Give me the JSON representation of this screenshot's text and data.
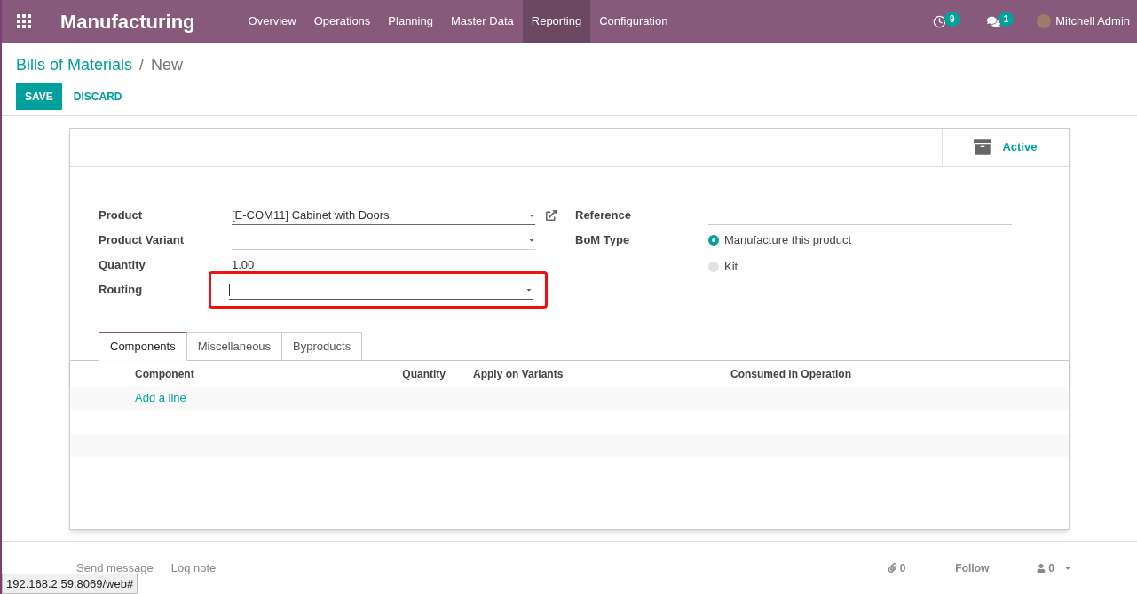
{
  "navbar": {
    "app_title": "Manufacturing",
    "menu": [
      {
        "label": "Overview",
        "selected": false
      },
      {
        "label": "Operations",
        "selected": false
      },
      {
        "label": "Planning",
        "selected": false
      },
      {
        "label": "Master Data",
        "selected": false
      },
      {
        "label": "Reporting",
        "selected": true
      },
      {
        "label": "Configuration",
        "selected": false
      }
    ],
    "activity_count": "9",
    "message_count": "1",
    "user": "Mitchell Admin"
  },
  "breadcrumb": {
    "parent": "Bills of Materials",
    "separator": "/",
    "current": "New"
  },
  "buttons": {
    "save": "SAVE",
    "discard": "DISCARD"
  },
  "status_button": {
    "label": "Active"
  },
  "left_fields": [
    {
      "label": "Product",
      "kind": "select",
      "value": "[E-COM11] Cabinet with Doors",
      "highlighted": false,
      "focused": false,
      "external_link": true
    },
    {
      "label": "Product Variant",
      "kind": "select",
      "highlighted": false,
      "focused": false,
      "external_link": false
    },
    {
      "label": "Quantity",
      "kind": "text",
      "value": "1.00",
      "highlighted": false,
      "focused": false,
      "external_link": false
    },
    {
      "label": "Routing",
      "kind": "select",
      "highlighted": true,
      "focused": true,
      "external_link": false
    }
  ],
  "reference": {
    "label": "Reference"
  },
  "bom_type": {
    "label": "BoM Type",
    "options": [
      {
        "label": "Manufacture this product",
        "selected": true
      },
      {
        "label": "Kit",
        "selected": false
      }
    ]
  },
  "tabs": [
    {
      "label": "Components",
      "selected": true
    },
    {
      "label": "Miscellaneous",
      "selected": false
    },
    {
      "label": "Byproducts",
      "selected": false
    }
  ],
  "table": {
    "columns": [
      "Component",
      "Quantity",
      "Apply on Variants",
      "Consumed in Operation"
    ],
    "add_line": "Add a line"
  },
  "chatter": {
    "send_message": "Send message",
    "log_note": "Log note",
    "attachments": "0",
    "follow": "Follow",
    "followers": "0"
  },
  "status_url": "192.168.2.59:8069/web#"
}
